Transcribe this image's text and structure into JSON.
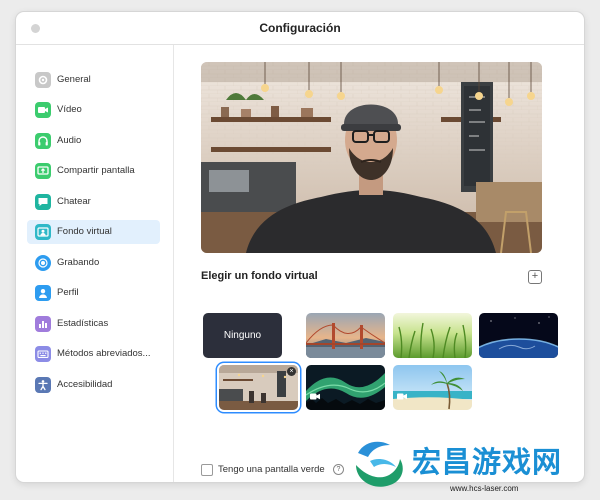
{
  "window": {
    "title": "Configuración"
  },
  "sidebar": {
    "items": [
      {
        "label": "General",
        "icon": "gear-icon",
        "color": "#c8c8c8"
      },
      {
        "label": "Vídeo",
        "icon": "video-icon",
        "color": "#3ccc6e"
      },
      {
        "label": "Audio",
        "icon": "headphones-icon",
        "color": "#3ccc6e"
      },
      {
        "label": "Compartir pantalla",
        "icon": "share-screen-icon",
        "color": "#3ccc6e"
      },
      {
        "label": "Chatear",
        "icon": "chat-icon",
        "color": "#1fb5a0"
      },
      {
        "label": "Fondo virtual",
        "icon": "virtual-background-icon",
        "color": "#2fb8c8",
        "active": true
      },
      {
        "label": "Grabando",
        "icon": "record-icon",
        "color": "#2d9cf0"
      },
      {
        "label": "Perfil",
        "icon": "profile-icon",
        "color": "#2d9cf0"
      },
      {
        "label": "Estadísticas",
        "icon": "statistics-icon",
        "color": "#a07cdc"
      },
      {
        "label": "Métodos abreviados...",
        "icon": "keyboard-icon",
        "color": "#8c8ce6"
      },
      {
        "label": "Accesibilidad",
        "icon": "accessibility-icon",
        "color": "#5a78b4"
      }
    ]
  },
  "main": {
    "section_title": "Elegir un fondo virtual",
    "add_icon": "plus-icon",
    "thumbnails": [
      {
        "label": "Ninguno",
        "kind": "none"
      },
      {
        "kind": "golden-gate"
      },
      {
        "kind": "grass"
      },
      {
        "kind": "earth"
      },
      {
        "kind": "cafe",
        "selected": true
      },
      {
        "kind": "aurora",
        "has_camera_icon": true
      },
      {
        "kind": "beach",
        "has_camera_icon": true
      }
    ],
    "green_screen_label": "Tengo una pantalla verde",
    "help_icon": "help-icon"
  },
  "watermark": {
    "text": "宏昌游戏网",
    "url": "www.hcs-laser.com"
  },
  "colors": {
    "accent": "#2d8cff",
    "active_bg": "#e2f0fd"
  }
}
